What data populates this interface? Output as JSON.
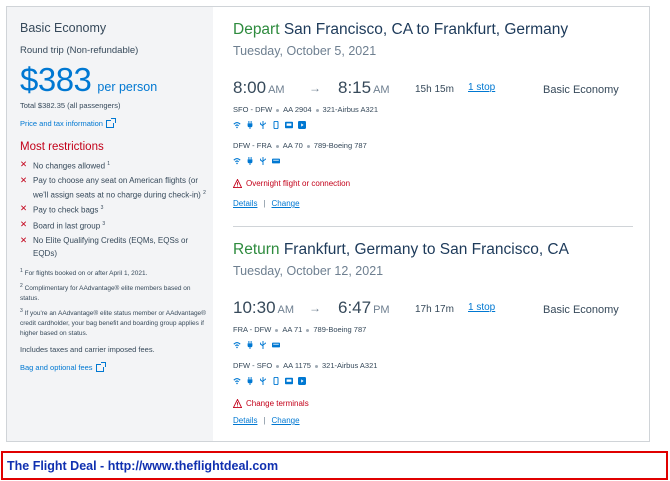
{
  "sidebar": {
    "fare_name": "Basic Economy",
    "trip_type": "Round trip (Non-refundable)",
    "price": "$383",
    "price_unit": "per person",
    "total": "Total $382.35 (all passengers)",
    "price_tax_link": "Price and tax information",
    "restrictions_title": "Most restrictions",
    "restrictions": [
      {
        "text": "No changes allowed",
        "sup": "1"
      },
      {
        "text": "Pay to choose any seat on American flights (or we'll assign seats at no charge during check-in)",
        "sup": "2"
      },
      {
        "text": "Pay to check bags",
        "sup": "3"
      },
      {
        "text": "Board in last group",
        "sup": "3"
      },
      {
        "text": "No Elite Qualifying Credits (EQMs, EQSs or EQDs)",
        "sup": ""
      }
    ],
    "footnotes": [
      {
        "sup": "1",
        "text": "For flights booked on or after April 1, 2021."
      },
      {
        "sup": "2",
        "text": "Complimentary for AAdvantage® elite members based on status."
      },
      {
        "sup": "3",
        "text": "If you're an AAdvantage® elite status member or AAdvantage® credit cardholder, your bag benefit and boarding group applies if higher based on status."
      }
    ],
    "includes": "Includes taxes and carrier imposed fees.",
    "bag_link": "Bag and optional fees"
  },
  "depart": {
    "direction": "Depart",
    "route": "San Francisco, CA to Frankfurt, Germany",
    "date": "Tuesday, October 5, 2021",
    "dep_time": "8:00",
    "dep_ampm": "AM",
    "arrow": "→",
    "arr_time": "8:15",
    "arr_ampm": "AM",
    "duration": "15h 15m",
    "stops": "1 stop",
    "cabin": "Basic Economy",
    "segments": [
      {
        "route": "SFO - DFW",
        "flight": "AA 2904",
        "aircraft": "321-Airbus A321"
      },
      {
        "route": "DFW - FRA",
        "flight": "AA 70",
        "aircraft": "789-Boeing 787"
      }
    ],
    "warning": "Overnight flight or connection",
    "details": "Details",
    "change": "Change",
    "separator": "|"
  },
  "return": {
    "direction": "Return",
    "route": "Frankfurt, Germany to San Francisco, CA",
    "date": "Tuesday, October 12, 2021",
    "dep_time": "10:30",
    "dep_ampm": "AM",
    "arrow": "→",
    "arr_time": "6:47",
    "arr_ampm": "PM",
    "duration": "17h 17m",
    "stops": "1 stop",
    "cabin": "Basic Economy",
    "segments": [
      {
        "route": "FRA - DFW",
        "flight": "AA 71",
        "aircraft": "789-Boeing 787"
      },
      {
        "route": "DFW - SFO",
        "flight": "AA 1175",
        "aircraft": "321-Airbus A321"
      }
    ],
    "warning": "Change terminals",
    "details": "Details",
    "change": "Change",
    "separator": "|"
  },
  "footer": {
    "text": "The Flight Deal - http://www.theflightdeal.com"
  },
  "colors": {
    "accent_blue": "#0078d2",
    "depart_green": "#2e8b3e",
    "restriction_red": "#c30019",
    "footer_border": "#e00000",
    "footer_text": "#1030b0"
  },
  "icons": [
    "wifi-icon",
    "power-icon",
    "usb-icon",
    "device-icon",
    "tv-icon",
    "entertainment-icon",
    "meal-icon",
    "external-link-icon",
    "warning-icon",
    "close-x-icon"
  ]
}
